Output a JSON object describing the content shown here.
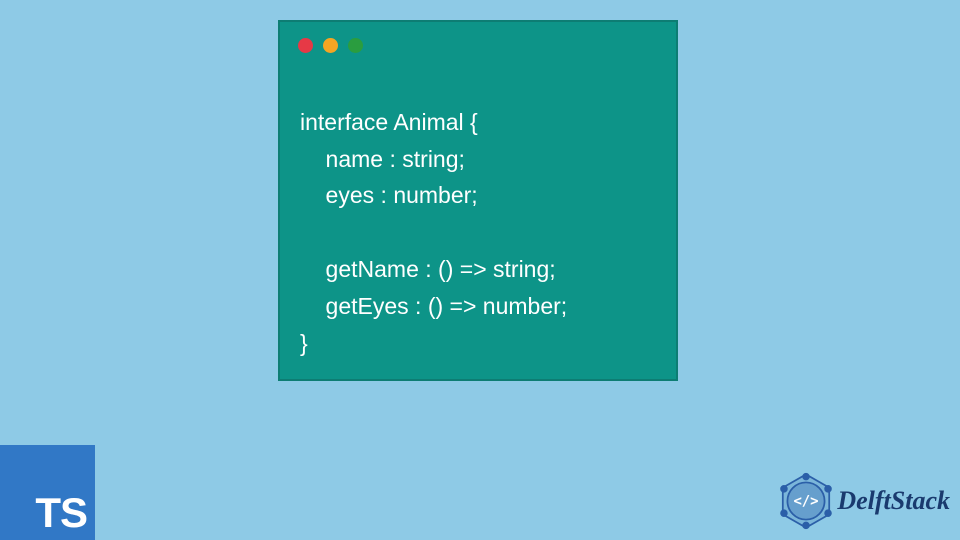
{
  "colors": {
    "background": "#8ecae6",
    "window": "#0d9488",
    "ts_badge": "#3178c6",
    "dot_red": "#e63946",
    "dot_yellow": "#f4a523",
    "dot_green": "#2a9d3f",
    "delft_primary": "#1a3a6e"
  },
  "code": {
    "lines": [
      "interface Animal {",
      "    name : string;",
      "    eyes : number;",
      "",
      "    getName : () => string;",
      "    getEyes : () => number;",
      "}"
    ]
  },
  "ts_badge": {
    "label": "TS"
  },
  "delft": {
    "label": "DelftStack",
    "icon_text": "</>"
  }
}
